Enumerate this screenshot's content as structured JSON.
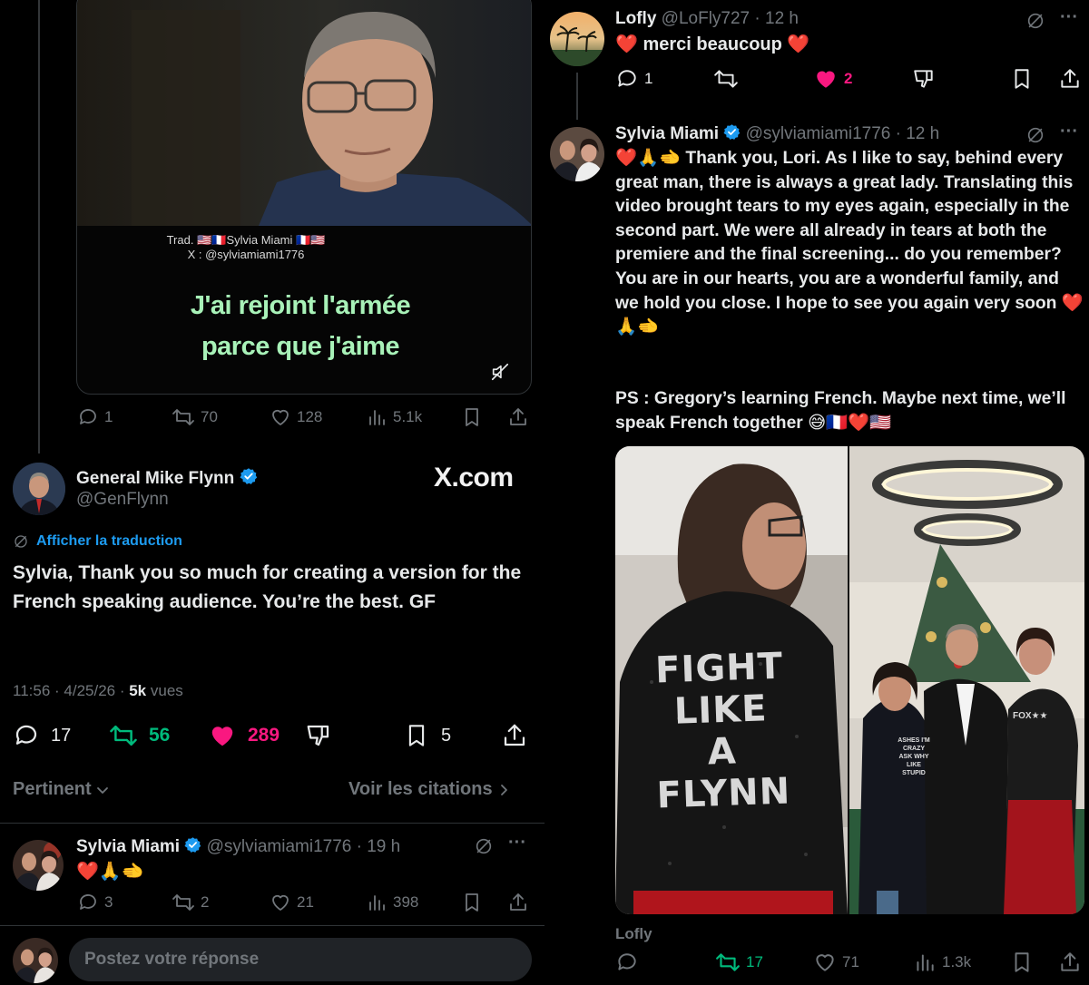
{
  "video": {
    "credit_line1": "Trad. 🇺🇸🇫🇷Sylvia Miami 🇫🇷🇺🇸",
    "credit_line2": "X : @sylviamiami1776",
    "subtitle_line1": "J'ai rejoint l'armée",
    "subtitle_line2": "parce que j'aime"
  },
  "quoted_actions": {
    "replies": "1",
    "reposts": "70",
    "likes": "128",
    "views": "5.1k"
  },
  "main_post": {
    "author_name": "General Mike Flynn",
    "handle": "@GenFlynn",
    "watermark": "X.com",
    "translate_label": "Afficher la traduction",
    "text": "Sylvia, Thank you so much for creating a version for the French speaking audience. You’re the best. GF",
    "timestamp": "11:56 · 4/25/26 · ",
    "views_count": "5k",
    "views_label": " vues",
    "replies": "17",
    "reposts": "56",
    "likes": "289",
    "bookmarks": "5",
    "accent_repost": "#00ba7c",
    "accent_like": "#f91880"
  },
  "sort": {
    "pertinent_label": "Pertinent",
    "quotes_label": "Voir les citations"
  },
  "reply_sylvia_1": {
    "author_name": "Sylvia Miami",
    "handle": "@sylviamiami1776",
    "time": " · 19 h",
    "text": "❤️🙏🫲",
    "replies": "3",
    "reposts": "2",
    "likes": "21",
    "views": "398"
  },
  "composer": {
    "placeholder": "Postez votre réponse"
  },
  "right_lofly": {
    "author_name": "Lofly",
    "handle": "@LoFly727",
    "time": " · 12 h",
    "text": "❤️ merci beaucoup ❤️",
    "replies": "1",
    "likes": "2"
  },
  "right_sylvia": {
    "author_name": "Sylvia Miami",
    "handle": "@sylviamiami1776",
    "time": " · 12 h",
    "text1": "❤️🙏🫲 Thank you, Lori. As I like to say, behind every great man, there is always a great lady. Translating this video brought tears to my eyes again, especially in the second part. We were all already in tears at both the premiere and the final screening... do you remember? You are in our hearts, you are a wonderful family, and we hold you close. I hope to see you again very soon ❤️🙏🫲",
    "text2": "PS : Gregory’s learning French. Maybe next time, we’ll speak French together 😅🇫🇷❤️🇺🇸",
    "jacket_text": "FIGHT LIKE A FLYNN",
    "shirt_text": "ASHES I'M CRAZY ASK WHY LIKE STUPID",
    "sleeve_text": "FOX★★"
  },
  "bottom_bar": {
    "name_label": "Lofly",
    "reposts": "17",
    "likes": "71",
    "views": "1.3k"
  }
}
